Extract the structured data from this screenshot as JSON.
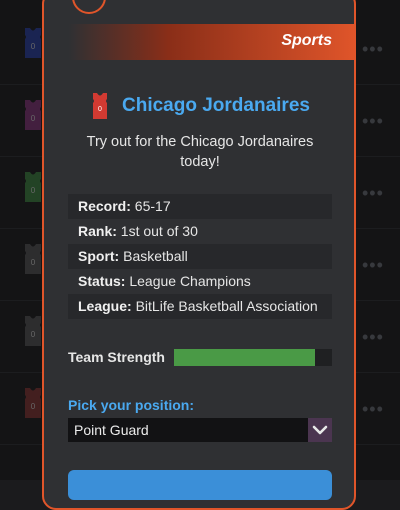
{
  "header": {
    "category_label": "Sports"
  },
  "team": {
    "name": "Chicago Jordanaires",
    "jersey_number": "0",
    "jersey_color": "#d23a32"
  },
  "tryout_message": "Try out for the Chicago Jordanaires today!",
  "stats": [
    {
      "key": "Record:",
      "value": "65-17"
    },
    {
      "key": "Rank:",
      "value": "1st out of 30"
    },
    {
      "key": "Sport:",
      "value": "Basketball"
    },
    {
      "key": "Status:",
      "value": "League Champions"
    },
    {
      "key": "League:",
      "value": "BitLife Basketball Association"
    }
  ],
  "team_strength": {
    "label": "Team Strength",
    "level_percent": 89,
    "color": "#4a9a46"
  },
  "position": {
    "label": "Pick your position:",
    "selected": "Point Guard"
  },
  "colors": {
    "accent": "#e0552a",
    "link": "#4aa9f0"
  },
  "background_list": {
    "rows": [
      {
        "number": "0",
        "color": "#23306e"
      },
      {
        "number": "0",
        "color": "#5a2a55"
      },
      {
        "number": "0",
        "color": "#2f5a32"
      },
      {
        "number": "0",
        "color": "#3c3c3e"
      },
      {
        "number": "0",
        "color": "#3c3c3e"
      },
      {
        "number": "0",
        "color": "#5a2a2a"
      }
    ]
  }
}
